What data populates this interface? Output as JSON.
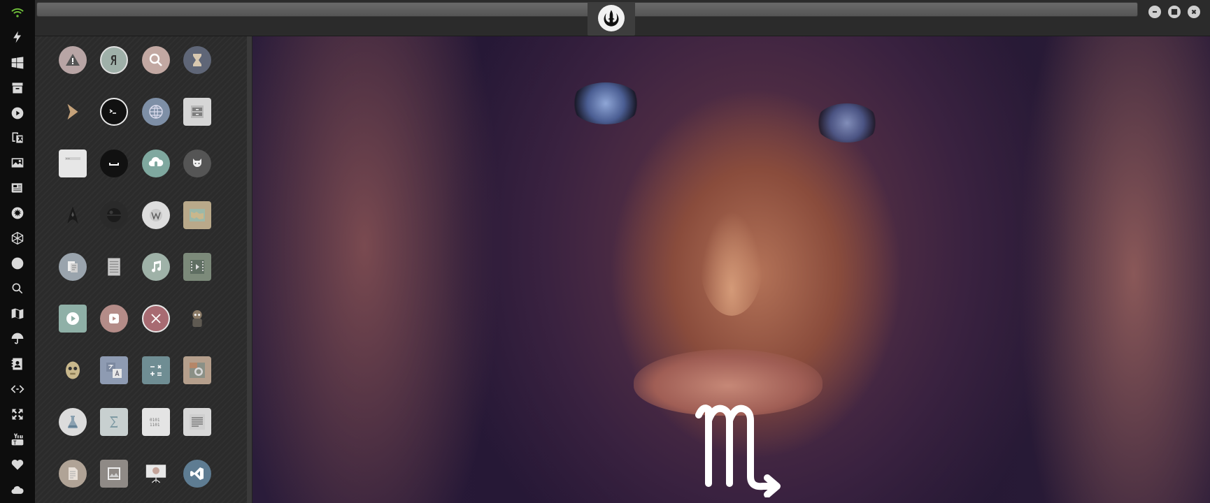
{
  "dock": {
    "items": [
      {
        "icon": "wifi-icon"
      },
      {
        "icon": "lightning-icon"
      },
      {
        "icon": "windows-icon"
      },
      {
        "icon": "archive-icon"
      },
      {
        "icon": "play-icon"
      },
      {
        "icon": "translate-icon"
      },
      {
        "icon": "image-icon"
      },
      {
        "icon": "news-icon"
      },
      {
        "icon": "rebel-alliance-icon"
      },
      {
        "icon": "hexagon-icon"
      },
      {
        "icon": "globe-icon"
      },
      {
        "icon": "search-icon"
      },
      {
        "icon": "map-icon"
      },
      {
        "icon": "umbrella-icon"
      },
      {
        "icon": "contact-card-icon"
      },
      {
        "icon": "code-icon"
      },
      {
        "icon": "fullscreen-icon"
      },
      {
        "icon": "youtube-icon"
      },
      {
        "icon": "heart-icon"
      },
      {
        "icon": "cloud-icon"
      }
    ]
  },
  "topbar": {
    "address_value": "",
    "tab_emblem": "rebel-alliance-icon",
    "window_buttons": [
      "minimize-icon",
      "maximize-icon",
      "close-icon"
    ]
  },
  "drawer": {
    "apps": [
      [
        "warning-icon",
        "yandex-icon",
        "search-icon",
        "hourglass-icon"
      ],
      [
        "chevron-right-icon",
        "terminal-icon",
        "globe-icon",
        "file-cabinet-icon"
      ],
      [
        "window-icon",
        "keyboard-icon",
        "cloud-lock-icon",
        "octocat-icon"
      ],
      [
        "starfleet-icon",
        "death-star-icon",
        "wikipedia-icon",
        "map-icon"
      ],
      [
        "documents-icon",
        "notes-icon",
        "music-icon",
        "video-icon"
      ],
      [
        "video-player-icon",
        "play-circle-icon",
        "close-circle-icon",
        "robot-icon"
      ],
      [
        "c3po-icon",
        "translate-icon",
        "calculator-icon",
        "camera-icon"
      ],
      [
        "flask-icon",
        "sigma-icon",
        "binary-file-icon",
        "text-editor-icon"
      ],
      [
        "document-icon",
        "image-viewer-icon",
        "presentation-icon",
        "vscode-icon"
      ]
    ]
  },
  "wallpaper": {
    "symbol": "scorpio-icon"
  },
  "colors": {
    "dock_bg": "#0d0d0d",
    "drawer_bg": "#2b2b2b",
    "topbar_bg": "#2b2b2b"
  }
}
